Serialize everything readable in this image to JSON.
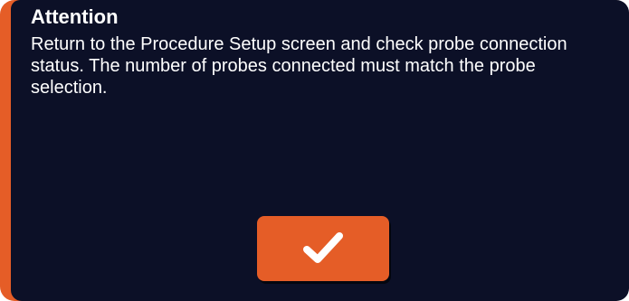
{
  "dialog": {
    "title": "Attention",
    "message": "Return to the Procedure Setup screen and check probe connection status.  The number of probes connected must match the probe selection.",
    "confirm_icon": "checkmark-icon"
  },
  "colors": {
    "accent": "#e55d27",
    "background": "#0c1027",
    "text": "#ffffff"
  }
}
